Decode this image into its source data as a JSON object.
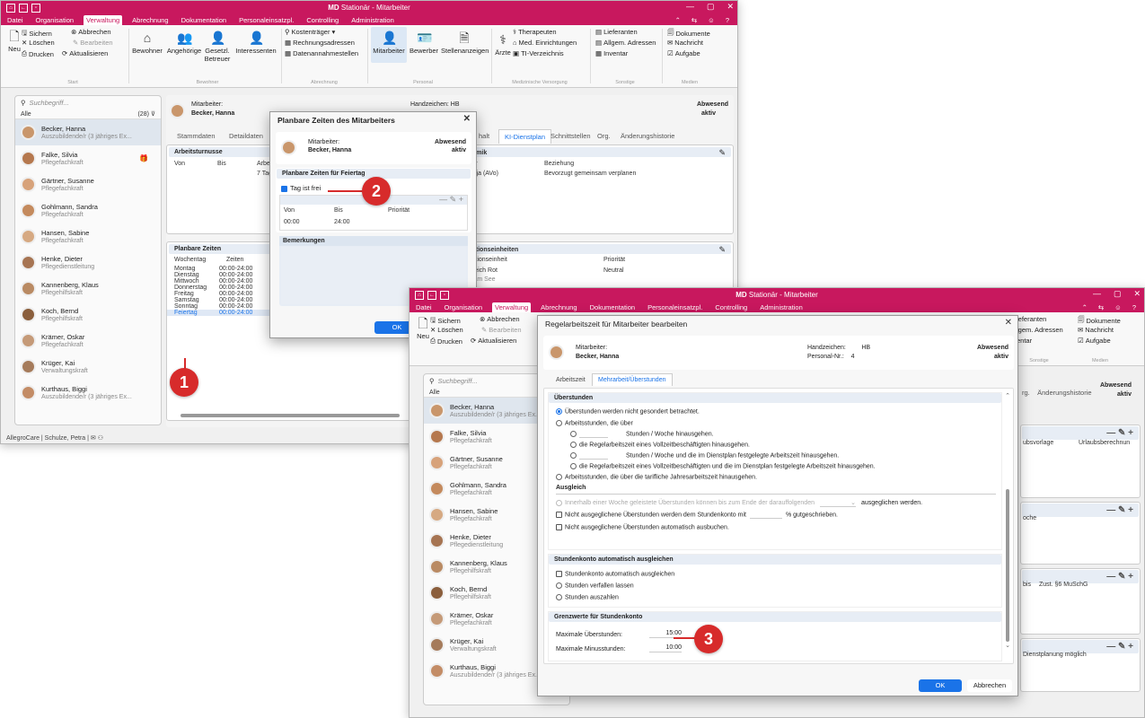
{
  "app": {
    "title_brand": "MD",
    "title_rest": " Stationär - Mitarbeiter",
    "menu": [
      "Datei",
      "Organisation",
      "Verwaltung",
      "Abrechnung",
      "Dokumentation",
      "Personaleinsatzpl.",
      "Controlling",
      "Administration"
    ],
    "active_menu": "Verwaltung",
    "status_user": "AllegroCare | Schulze, Petra |"
  },
  "ribbon": {
    "neu": "Neu",
    "sichern": "Sichern",
    "abbrechen": "Abbrechen",
    "loeschen": "Löschen",
    "bearbeiten": "Bearbeiten",
    "drucken": "Drucken",
    "aktualisieren": "Aktualisieren",
    "grp_start": "Start",
    "bewohner": "Bewohner",
    "angehoerige": "Angehörige",
    "betreuer1": "Gesetzl.",
    "betreuer2": "Betreuer",
    "interessenten": "Interessenten",
    "grp_bewohner": "Bewohner",
    "kostentraeger": "Kostenträger",
    "rechnungsadressen": "Rechnungsadressen",
    "datenannahme": "Datenannahmestellen",
    "grp_abrechnung": "Abrechnung",
    "mitarbeiter": "Mitarbeiter",
    "bewerber": "Bewerber",
    "stellenanzeigen": "Stellenanzeigen",
    "grp_personal": "Personal",
    "aerzte": "Ärzte",
    "therapeuten": "Therapeuten",
    "med_einr": "Med. Einrichtungen",
    "ti_verz": "TI-Verzeichnis",
    "grp_med": "Medizinische Versorgung",
    "lieferanten": "Lieferanten",
    "allg_adressen": "Allgem. Adressen",
    "inventar": "Inventar",
    "grp_sonstige": "Sonstige",
    "dokumente": "Dokumente",
    "nachricht": "Nachricht",
    "aufgabe": "Aufgabe",
    "grp_medien": "Medien"
  },
  "sidebar": {
    "search_placeholder": "Suchbegriff...",
    "filter": "Alle",
    "count": "(28)",
    "items": [
      {
        "name": "Becker, Hanna",
        "role": "Auszubildende/r (3 jähriges Ex..."
      },
      {
        "name": "Falke, Silvia",
        "role": "Pflegefachkraft"
      },
      {
        "name": "Gärtner, Susanne",
        "role": "Pflegefachkraft"
      },
      {
        "name": "Gohlmann, Sandra",
        "role": "Pflegefachkraft"
      },
      {
        "name": "Hansen, Sabine",
        "role": "Pflegefachkraft"
      },
      {
        "name": "Henke, Dieter",
        "role": "Pflegedienstleitung"
      },
      {
        "name": "Kannenberg, Klaus",
        "role": "Pflegehilfskraft"
      },
      {
        "name": "Koch, Bernd",
        "role": "Pflegehilfskraft"
      },
      {
        "name": "Krämer, Oskar",
        "role": "Pflegefachkraft"
      },
      {
        "name": "Krüger, Kai",
        "role": "Verwaltungskraft"
      },
      {
        "name": "Kurthaus, Biggi",
        "role": "Auszubildende/r (3 jähriges Ex..."
      }
    ]
  },
  "employee": {
    "label": "Mitarbeiter:",
    "name": "Becker, Hanna",
    "handzeichen_label": "Handzeichen:",
    "handzeichen": "HB",
    "status1": "Abwesend",
    "status2": "aktiv",
    "personal_label": "Personal-Nr.:",
    "personal_nr": "4"
  },
  "tabs_back": [
    "Stammdaten",
    "Detaildaten",
    "halt",
    "KI-Dienstplan",
    "Schnittstellen",
    "Org.",
    "Änderungshistorie"
  ],
  "back": {
    "arbeitsturnusse": "Arbeitsturnusse",
    "von": "Von",
    "bis": "Bis",
    "arbe": "Arbe",
    "sieben": "7 Tag",
    "namik": "namik",
    "iter": "iter",
    "beziehung": "Beziehung",
    "anja": "Anja (AVo)",
    "bevorzugt": "Bevorzugt gemeinsam verplanen",
    "planbare": "Planbare Zeiten",
    "wochentag": "Wochentag",
    "zeiten": "Zeiten",
    "days": [
      {
        "d": "Montag",
        "t": "00:00-24:00"
      },
      {
        "d": "Dienstag",
        "t": "00:00-24:00"
      },
      {
        "d": "Mittwoch",
        "t": "00:00-24:00"
      },
      {
        "d": "Donnerstag",
        "t": "00:00-24:00"
      },
      {
        "d": "Freitag",
        "t": "00:00-24:00"
      },
      {
        "d": "Samstag",
        "t": "00:00-24:00"
      },
      {
        "d": "Sonntag",
        "t": "00:00-24:00"
      },
      {
        "d": "Feiertag",
        "t": "00:00-24:00"
      }
    ],
    "sationseinheiten": "sationseinheiten",
    "sationseinheit": "sationseinheit",
    "prioritaet": "Priorität",
    "bereich": "ereich Rot",
    "neutral": "Neutral",
    "am_see": "z am See"
  },
  "dialog1": {
    "title": "Planbare Zeiten des Mitarbeiters",
    "section": "Planbare Zeiten für Feiertag",
    "tag_frei": "Tag ist frei",
    "col_von": "Von",
    "col_bis": "Bis",
    "col_prio": "Priorität",
    "row_von": "00:00",
    "row_bis": "24:00",
    "bemerkungen": "Bemerkungen",
    "ok": "OK"
  },
  "dialog2": {
    "title": "Regelarbeitszeit für Mitarbeiter bearbeiten",
    "tab1": "Arbeitszeit",
    "tab2": "Mehrarbeit/Überstunden",
    "ueberstunden": "Überstunden",
    "r1": "Überstunden werden nicht gesondert betrachtet.",
    "r2": "Arbeitsstunden, die über",
    "r2a": "Stunden / Woche hinausgehen.",
    "r2b": "die Regelarbeitszeit eines Vollzeitbeschäftigten hinausgehen.",
    "r2c": "Stunden / Woche und die im Dienstplan festgelegte Arbeitszeit hinausgehen.",
    "r2d": "die Regelarbeitszeit eines Vollzeitbeschäftigten und die im Dienstplan festgelegte Arbeitszeit hinausgehen.",
    "r3": "Arbeitsstunden, die über die tarifliche Jahresarbeitszeit hinausgehen.",
    "ausgleich": "Ausgleich",
    "a1": "Innerhalb einer Woche geleistete Überstunden können bis zum Ende der darauffolgenden",
    "a1b": "ausgeglichen werden.",
    "a2": "Nicht ausgeglichene Überstunden werden dem Stundenkonto mit",
    "a2b": "% gutgeschrieben.",
    "a3": "Nicht ausgeglichene Überstunden automatisch ausbuchen.",
    "konto": "Stundenkonto automatisch ausgleichen",
    "k1": "Stundenkonto automatisch ausgleichen",
    "k2": "Stunden verfallen lassen",
    "k3": "Stunden auszahlen",
    "grenz": "Grenzwerte für Stundenkonto",
    "max_label": "Maximale Überstunden:",
    "max_val": "15:00",
    "min_label": "Maximale Minusstunden:",
    "min_val": "10:00",
    "ok": "OK",
    "cancel": "Abbrechen"
  },
  "right_bits": {
    "ieferanten": "ieferanten",
    "lgem": "lgem. Adressen",
    "entar": "entar",
    "rg": "rg.",
    "aender": "Änderungshistorie",
    "ubsvorlage": "ubsvorlage",
    "urlaubsber": "Urlaubsberechnun",
    "oche": "oche",
    "bis": "bis",
    "zust": "Zust. §6 MuSchG",
    "dienstplanung": "Dienstplanung möglich",
    "dokumente": "Dokumente",
    "nachricht": "Nachricht",
    "aufgabe": "Aufgabe"
  },
  "markers": [
    "1",
    "2",
    "3"
  ],
  "colors": {
    "brand": "#c8185e",
    "accent": "#1a73e8",
    "marker": "#d72b2b"
  }
}
